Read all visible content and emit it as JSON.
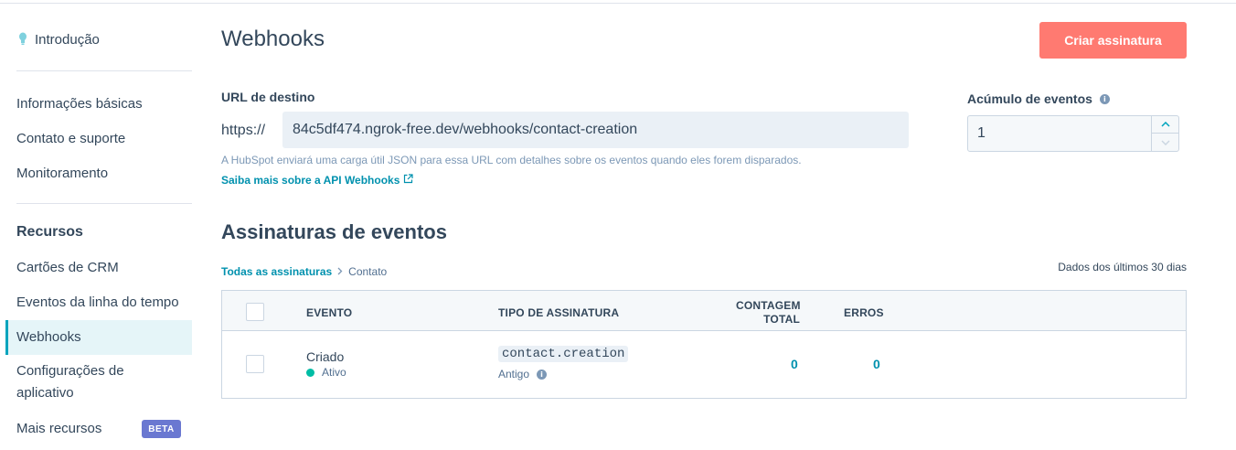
{
  "sidebar": {
    "intro": "Introdução",
    "items_top": [
      "Informações básicas",
      "Contato e suporte",
      "Monitoramento"
    ],
    "resources_heading": "Recursos",
    "items_resources": [
      "Cartões de CRM",
      "Eventos da linha do tempo",
      "Webhooks",
      "Configurações de aplicativo",
      "Mais recursos"
    ],
    "active_item": "Webhooks",
    "beta_badge": "BETA"
  },
  "header": {
    "title": "Webhooks",
    "create_button": "Criar assinatura"
  },
  "target_url": {
    "label": "URL de destino",
    "prefix": "https://",
    "value": "84c5df474.ngrok-free.dev/webhooks/contact-creation",
    "help_text": "A HubSpot enviará uma carga útil JSON para essa URL com detalhes sobre os eventos quando eles forem disparados.",
    "link_text": "Saiba mais sobre a API Webhooks"
  },
  "accumulation": {
    "label": "Acúmulo de eventos",
    "value": "1"
  },
  "subscriptions": {
    "title": "Assinaturas de eventos",
    "breadcrumb_link": "Todas as assinaturas",
    "breadcrumb_current": "Contato",
    "data_range": "Dados dos últimos 30 dias",
    "columns": {
      "event": "EVENTO",
      "type": "TIPO DE ASSINATURA",
      "count_line1": "CONTAGEM",
      "count_line2": "TOTAL",
      "errors": "ERROS"
    },
    "rows": [
      {
        "event": "Criado",
        "status": "Ativo",
        "type_code": "contact.creation",
        "type_sub": "Antigo",
        "total": "0",
        "errors": "0"
      }
    ]
  },
  "colors": {
    "primary_button": "#ff7a71",
    "link": "#0091ae",
    "active_bg": "#e5f5f8",
    "status_active": "#00bda5",
    "beta": "#6a78d1"
  },
  "icons": [
    "lightbulb-icon",
    "info-icon",
    "external-link-icon",
    "chevron-right-icon",
    "chevron-up-icon",
    "chevron-down-icon"
  ]
}
